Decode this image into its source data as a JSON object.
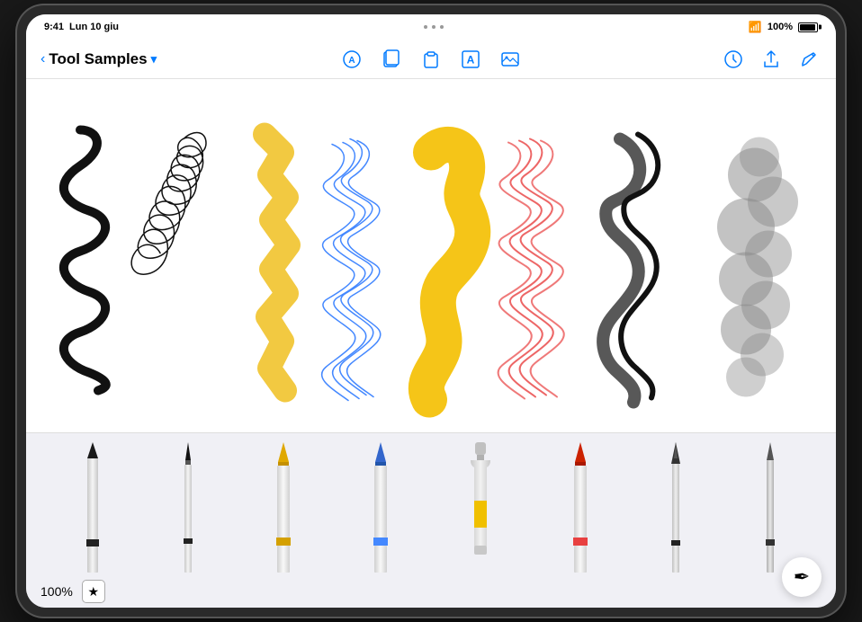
{
  "statusBar": {
    "time": "9:41",
    "day": "Lun 10 giu",
    "battery": "100%"
  },
  "toolbar": {
    "backLabel": "<",
    "title": "Tool Samples",
    "chevron": "▾",
    "icons": {
      "annotate": "⊕",
      "pages": "▣",
      "clipboard": "⎘",
      "text": "A",
      "image": "⊡",
      "history": "◷",
      "share": "↑",
      "edit": "✎"
    }
  },
  "canvas": {
    "strokes": [
      {
        "type": "snake-black",
        "color": "#111"
      },
      {
        "type": "loops-black",
        "color": "#111"
      },
      {
        "type": "ribbon-yellow",
        "color": "#f5c518"
      },
      {
        "type": "scribble-blue",
        "color": "#4488ff"
      },
      {
        "type": "blob-yellow",
        "color": "#f5c518"
      },
      {
        "type": "scribble-red",
        "color": "#e84040"
      },
      {
        "type": "calligraphy-black",
        "color": "#111"
      },
      {
        "type": "cloud-gray",
        "color": "#888"
      }
    ]
  },
  "tools": {
    "zoom": "100%",
    "starLabel": "★",
    "items": [
      {
        "name": "pencil",
        "color": "#333",
        "band": "#333"
      },
      {
        "name": "fineliner",
        "color": "#333",
        "band": "#333"
      },
      {
        "name": "marker-yellow",
        "color": "#f0b800",
        "band": "#f0b800"
      },
      {
        "name": "marker-blue",
        "color": "#4488ff",
        "band": "#4488ff"
      },
      {
        "name": "paint-bucket",
        "color": "#f0b800",
        "band": "#f0b800"
      },
      {
        "name": "crayon-red",
        "color": "#e84040",
        "band": "#e84040"
      },
      {
        "name": "nib-pen",
        "color": "#333",
        "band": "#333"
      },
      {
        "name": "brush-gray",
        "color": "#666",
        "band": "#333"
      }
    ],
    "fabIcon": "✒"
  }
}
